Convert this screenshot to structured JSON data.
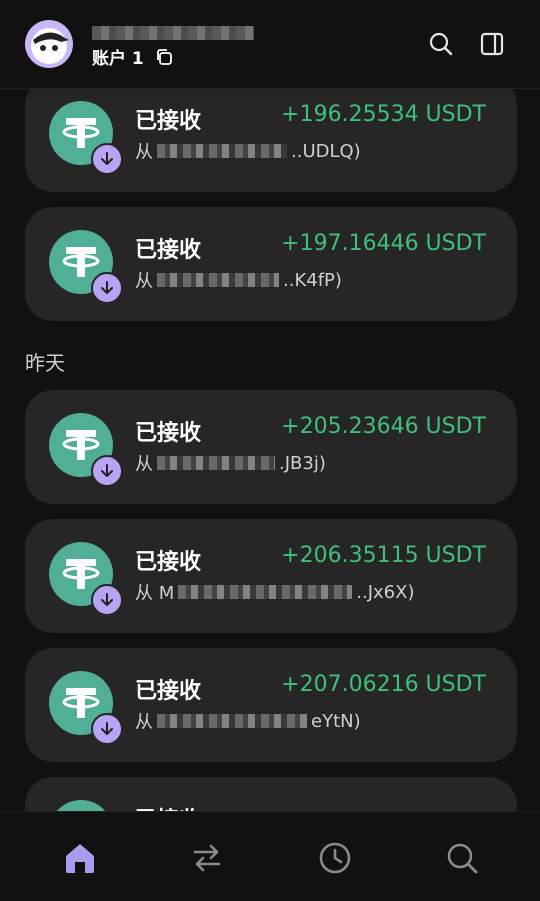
{
  "header": {
    "account_label": "账户 1"
  },
  "section_yesterday": "昨天",
  "transactions": [
    {
      "title": "已接收",
      "amount": "+196.25534 USDT",
      "from_prefix": "从",
      "address_tail": "..UDLQ)"
    },
    {
      "title": "已接收",
      "amount": "+197.16446 USDT",
      "from_prefix": "从",
      "address_tail": "..K4fP)"
    },
    {
      "title": "已接收",
      "amount": "+205.23646 USDT",
      "from_prefix": "从",
      "address_tail": ".JB3j)"
    },
    {
      "title": "已接收",
      "amount": "+206.35115 USDT",
      "from_prefix": "从 M",
      "address_tail": "..Jx6X)"
    },
    {
      "title": "已接收",
      "amount": "+207.06216 USDT",
      "from_prefix": "从",
      "address_tail": "eYtN)"
    },
    {
      "title": "已接收",
      "amount": "",
      "from_prefix": "",
      "address_tail": ""
    }
  ],
  "nav": [
    "home-icon",
    "swap-icon",
    "history-icon",
    "search-icon"
  ],
  "colors": {
    "accent": "#a99cf0",
    "received": "#3fbf7a",
    "tether": "#50af95"
  }
}
